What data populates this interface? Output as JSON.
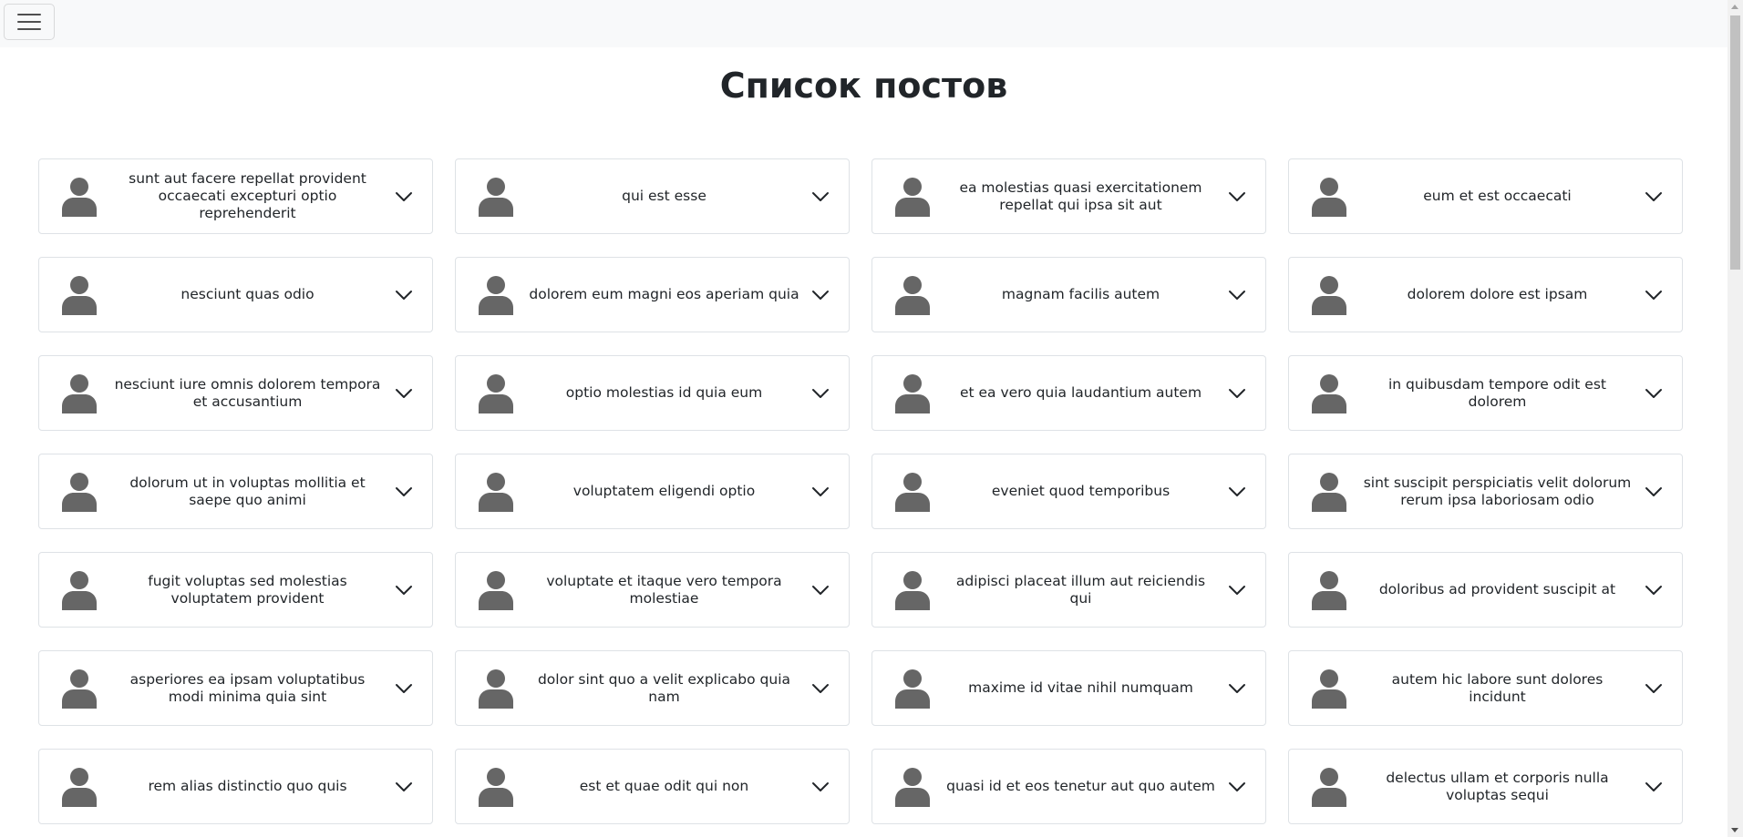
{
  "navbar": {
    "menu_icon": "hamburger-menu-icon"
  },
  "page": {
    "title": "Список постов"
  },
  "icons": {
    "avatar": "user-avatar-icon",
    "expand": "chevron-down-icon"
  },
  "colors": {
    "navbar_bg": "#f8f9fa",
    "card_border": "#dee2e6",
    "avatar": "#666666",
    "text": "#212529"
  },
  "posts": [
    {
      "title": "sunt aut facere repellat provident occaecati excepturi optio reprehenderit"
    },
    {
      "title": "qui est esse"
    },
    {
      "title": "ea molestias quasi exercitationem repellat qui ipsa sit aut"
    },
    {
      "title": "eum et est occaecati"
    },
    {
      "title": "nesciunt quas odio"
    },
    {
      "title": "dolorem eum magni eos aperiam quia"
    },
    {
      "title": "magnam facilis autem"
    },
    {
      "title": "dolorem dolore est ipsam"
    },
    {
      "title": "nesciunt iure omnis dolorem tempora et accusantium"
    },
    {
      "title": "optio molestias id quia eum"
    },
    {
      "title": "et ea vero quia laudantium autem"
    },
    {
      "title": "in quibusdam tempore odit est dolorem"
    },
    {
      "title": "dolorum ut in voluptas mollitia et saepe quo animi"
    },
    {
      "title": "voluptatem eligendi optio"
    },
    {
      "title": "eveniet quod temporibus"
    },
    {
      "title": "sint suscipit perspiciatis velit dolorum rerum ipsa laboriosam odio"
    },
    {
      "title": "fugit voluptas sed molestias voluptatem provident"
    },
    {
      "title": "voluptate et itaque vero tempora molestiae"
    },
    {
      "title": "adipisci placeat illum aut reiciendis qui"
    },
    {
      "title": "doloribus ad provident suscipit at"
    },
    {
      "title": "asperiores ea ipsam voluptatibus modi minima quia sint"
    },
    {
      "title": "dolor sint quo a velit explicabo quia nam"
    },
    {
      "title": "maxime id vitae nihil numquam"
    },
    {
      "title": "autem hic labore sunt dolores incidunt"
    },
    {
      "title": "rem alias distinctio quo quis"
    },
    {
      "title": "est et quae odit qui non"
    },
    {
      "title": "quasi id et eos tenetur aut quo autem"
    },
    {
      "title": "delectus ullam et corporis nulla voluptas sequi"
    }
  ]
}
